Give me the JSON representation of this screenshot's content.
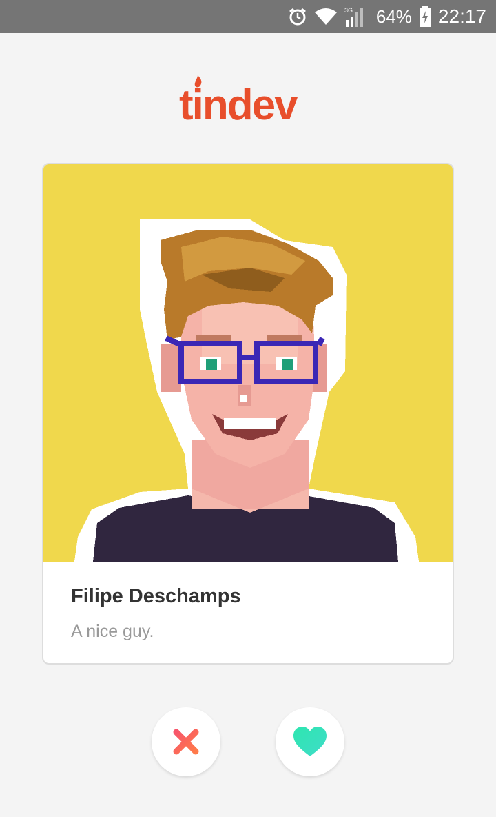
{
  "status_bar": {
    "network": "3G",
    "battery_percent": "64%",
    "time": "22:17",
    "icons": [
      "alarm-icon",
      "wifi-icon",
      "signal-icon",
      "battery-charging-icon"
    ]
  },
  "logo": {
    "text": "tindev",
    "color": "#e84e2b"
  },
  "profile": {
    "name": "Filipe Deschamps",
    "bio": "A nice guy.",
    "photo_background": "#f0d84c"
  },
  "actions": {
    "dislike_icon": "close-icon",
    "like_icon": "heart-icon",
    "dislike_color": "#f05a5a",
    "like_color": "#2ee6b0"
  }
}
